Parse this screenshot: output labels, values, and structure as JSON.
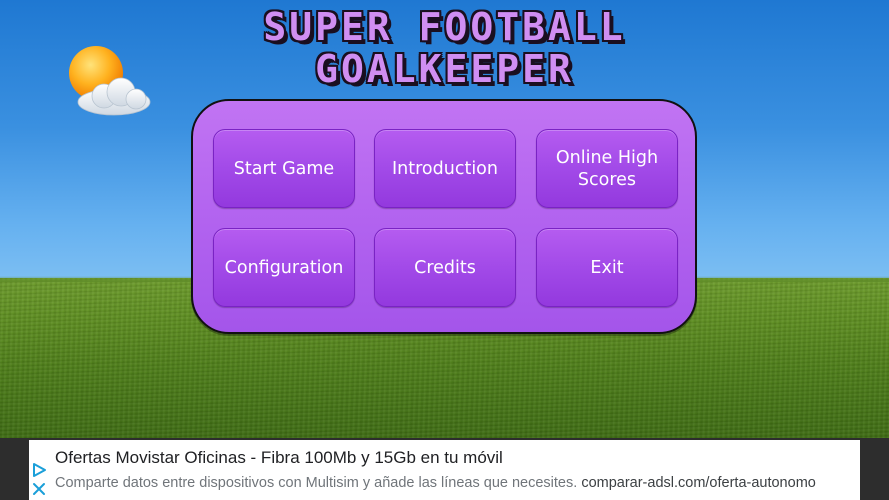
{
  "game": {
    "title_line1": "SUPER FOOTBALL",
    "title_line2": "GOALKEEPER"
  },
  "menu": {
    "start_game": "Start Game",
    "introduction": "Introduction",
    "online_high_scores": "Online High Scores",
    "configuration": "Configuration",
    "credits": "Credits",
    "exit": "Exit"
  },
  "ad": {
    "headline": "Ofertas Movistar Oficinas - Fibra 100Mb y 15Gb en tu móvil",
    "description": "Comparte datos entre dispositivos con Multisim y añade las líneas que necesites.",
    "display_url": "comparar-adsl.com/oferta-autonomo",
    "adchoices_icon": "adchoices-play-icon",
    "close_icon": "close-x-icon",
    "accent_color": "#1a9fd9"
  },
  "colors": {
    "title_fill": "#d08ef2",
    "panel_fill": "#b162ef",
    "button_fill": "#a24ae8",
    "sky": "#3a90e0",
    "grass": "#5f8f22"
  },
  "icons": {
    "weather": "sun-behind-cloud-icon"
  }
}
